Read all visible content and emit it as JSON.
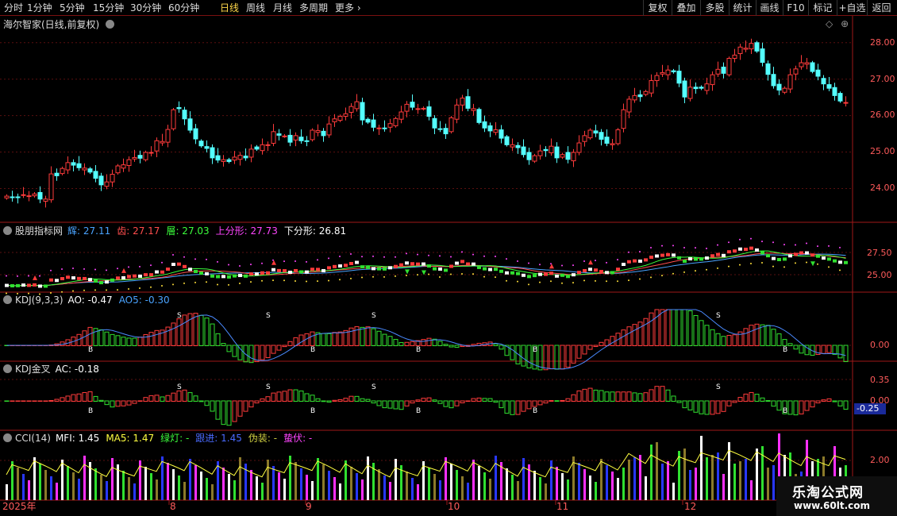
{
  "toolbar": {
    "periods": [
      "分时",
      "1分钟",
      "5分钟",
      "15分钟",
      "30分钟",
      "60分钟",
      "日线",
      "周线",
      "月线",
      "多周期",
      "更多 ›"
    ],
    "active_period": "日线",
    "buttons": [
      "复权",
      "叠加",
      "多股",
      "统计",
      "画线",
      "F10",
      "+自选",
      "返回"
    ],
    "last_button": "标记"
  },
  "main": {
    "title": "海尔智家(日线,前复权)",
    "price_axis": [
      "28.00",
      "27.00",
      "26.00",
      "25.00",
      "24.00"
    ]
  },
  "panel1": {
    "name": "股朋指标网",
    "items": [
      {
        "label": "辉: 27.11",
        "color": "#4aa3ff"
      },
      {
        "label": "齿: 27.17",
        "color": "#ff4d4d"
      },
      {
        "label": "層: 27.03",
        "color": "#3cff3c"
      },
      {
        "label": "上分形: 27.73",
        "color": "#ff45ff"
      },
      {
        "label": "下分形: 26.81",
        "color": "#ffffff"
      }
    ],
    "axis": [
      "27.50",
      "25.00"
    ]
  },
  "panel2": {
    "name": "KDJ(9,3,3)",
    "items": [
      {
        "label": "AO: -0.47",
        "color": "#ffffff"
      },
      {
        "label": "AO5: -0.30",
        "color": "#4aa3ff"
      }
    ],
    "axis": [
      "0.00"
    ]
  },
  "panel3": {
    "name": "KDJ金叉",
    "items": [
      {
        "label": "AC: -0.18",
        "color": "#ffffff"
      }
    ],
    "axis": [
      "0.35",
      "0.00"
    ],
    "current_value": "-0.25"
  },
  "panel4": {
    "name": "CCI(14)",
    "items": [
      {
        "label": "MFI: 1.45",
        "color": "#ffffff"
      },
      {
        "label": "MA5: 1.47",
        "color": "#ffff40"
      },
      {
        "label": "绿灯: -",
        "color": "#3cff3c"
      },
      {
        "label": "跟进: 1.45",
        "color": "#4a6bff"
      },
      {
        "label": "伪装: -",
        "color": "#cccc40"
      },
      {
        "label": "蛰伏: -",
        "color": "#ff45ff"
      }
    ],
    "axis": [
      "2.00"
    ]
  },
  "x_axis": [
    "2025年",
    "8",
    "9",
    "10",
    "11",
    "12"
  ],
  "watermark": {
    "title": "乐淘公式网",
    "url": "www.60lt.com"
  },
  "chart_data": {
    "type": "candlestick",
    "candle_count": 150,
    "price_range": [
      23.4,
      28.3
    ],
    "closes": [
      23.79,
      23.75,
      23.76,
      23.83,
      23.8,
      23.85,
      23.71,
      23.71,
      24.4,
      24.35,
      24.55,
      24.71,
      24.64,
      24.57,
      24.56,
      24.45,
      24.28,
      24.1,
      24.18,
      24.39,
      24.62,
      24.65,
      24.79,
      24.85,
      24.83,
      24.99,
      24.99,
      25.31,
      25.29,
      25.62,
      26.16,
      26.19,
      25.91,
      25.6,
      25.36,
      25.17,
      25.1,
      24.84,
      24.78,
      24.79,
      24.74,
      24.86,
      24.91,
      24.84,
      25.08,
      25.08,
      25.2,
      25.2,
      25.56,
      25.46,
      25.44,
      25.27,
      25.45,
      25.31,
      25.3,
      25.6,
      25.59,
      25.45,
      25.77,
      25.91,
      25.98,
      26.05,
      26.25,
      26.38,
      25.88,
      25.82,
      25.68,
      25.66,
      25.64,
      25.78,
      25.92,
      26.1,
      26.31,
      26.23,
      26.19,
      26.2,
      25.98,
      25.66,
      25.63,
      25.5,
      25.94,
      26.29,
      26.48,
      26.2,
      26.19,
      25.81,
      25.66,
      25.58,
      25.61,
      25.38,
      25.2,
      25.2,
      25.12,
      24.93,
      24.79,
      24.9,
      25.03,
      25.04,
      25.16,
      24.84,
      24.93,
      24.8,
      24.99,
      25.25,
      25.45,
      25.6,
      25.52,
      25.35,
      25.24,
      25.23,
      25.61,
      26.16,
      26.45,
      26.55,
      26.52,
      26.66,
      26.96,
      27.1,
      27.18,
      27.25,
      27.2,
      26.89,
      26.51,
      26.78,
      26.74,
      26.75,
      26.87,
      27.12,
      27.27,
      27.16,
      27.57,
      27.66,
      27.88,
      27.85,
      27.98,
      27.77,
      27.46,
      27.13,
      26.82,
      26.7,
      26.75,
      27.12,
      27.28,
      27.45,
      27.45,
      27.21,
      27.08,
      26.87,
      26.75,
      26.55,
      26.4,
      26.36
    ]
  }
}
